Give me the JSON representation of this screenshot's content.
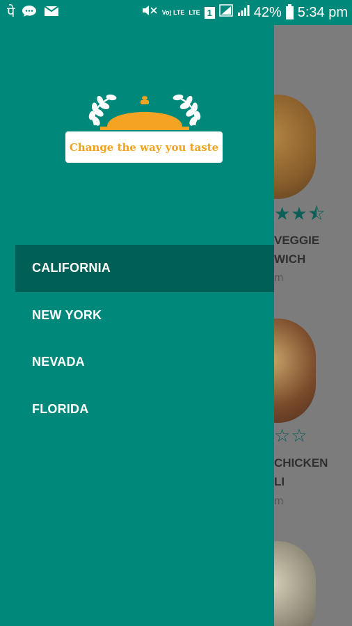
{
  "status_bar": {
    "left_icons": [
      "pe-icon",
      "message-icon",
      "mail-icon"
    ],
    "volte_label": "Vo) LTE",
    "lte_label": "LTE",
    "sim_label": "1",
    "battery": "42%",
    "time": "5:34 pm"
  },
  "drawer": {
    "tagline": "Change the way you taste",
    "menu": [
      {
        "label": "CALIFORNIA",
        "active": true
      },
      {
        "label": "NEW YORK",
        "active": false
      },
      {
        "label": "NEVADA",
        "active": false
      },
      {
        "label": "FLORIDA",
        "active": false
      }
    ]
  },
  "background_list": {
    "items": [
      {
        "stars": "★★⯪",
        "name_line1": "VEGGIE",
        "name_line2": "WICH",
        "sub": "m",
        "rating": 2.5
      },
      {
        "stars": "☆☆",
        "name_line1": "CHICKEN",
        "name_line2": "LI",
        "sub": "m",
        "rating": 0
      }
    ]
  },
  "colors": {
    "primary": "#00897b",
    "active_item": "#005f56",
    "accent": "#f2a31c"
  }
}
